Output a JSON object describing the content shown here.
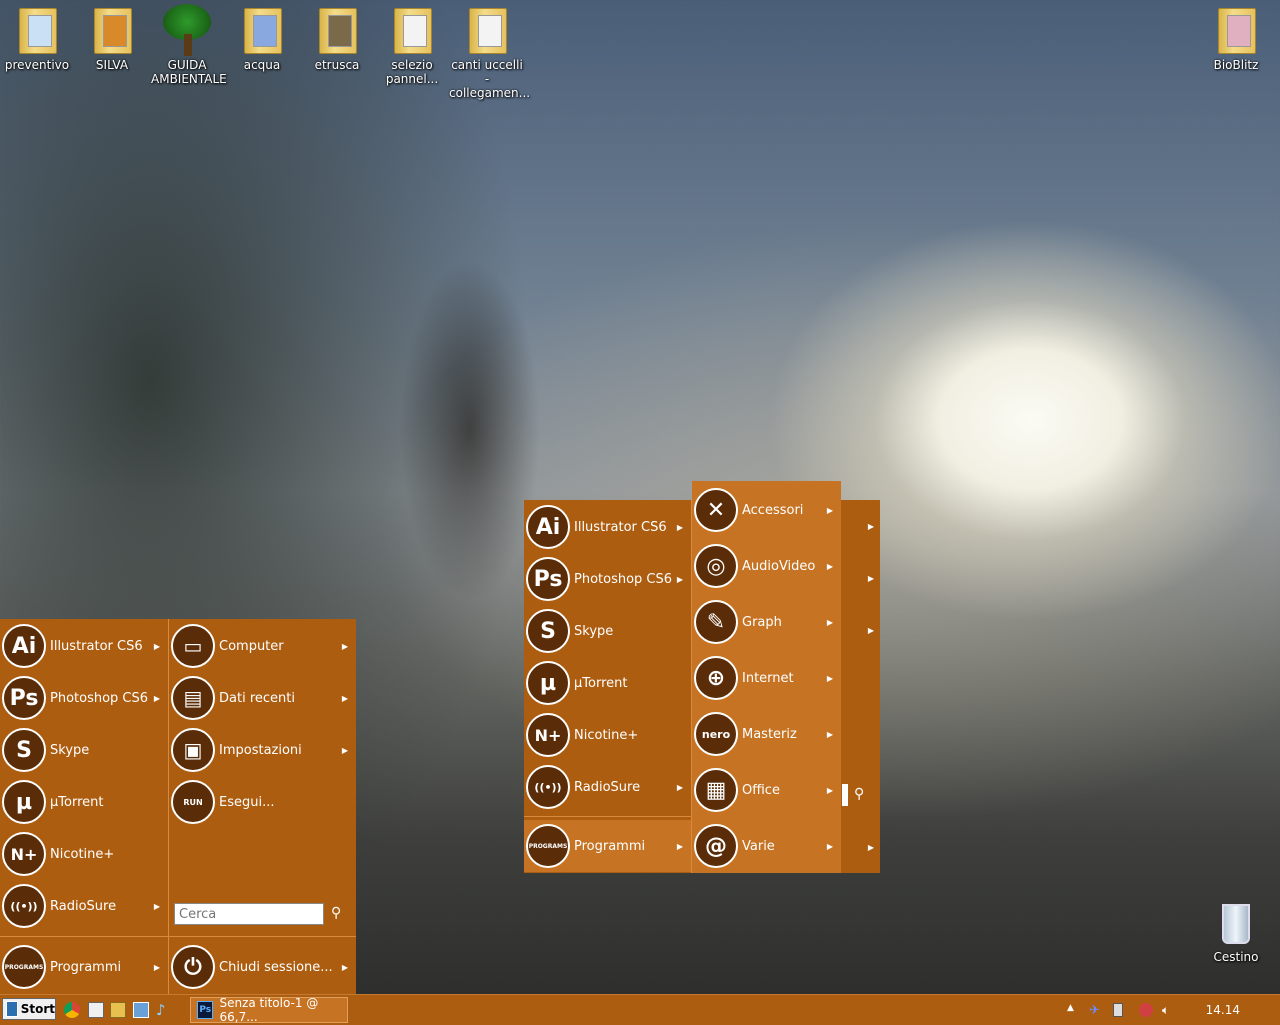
{
  "desktop": {
    "icons": [
      {
        "label": "preventivo"
      },
      {
        "label": "SILVA"
      },
      {
        "label": "GUIDA AMBIENTALE"
      },
      {
        "label": "acqua"
      },
      {
        "label": "etrusca"
      },
      {
        "label": "selezio pannel..."
      },
      {
        "label": "canti uccelli - collegamen..."
      },
      {
        "label": "BioBlitz"
      },
      {
        "label": "Cestino"
      }
    ]
  },
  "start_menu": {
    "left_items": [
      {
        "icon": "Ai",
        "label": "Illustrator CS6"
      },
      {
        "icon": "Ps",
        "label": "Photoshop CS6"
      },
      {
        "icon": "S",
        "label": "Skype"
      },
      {
        "icon": "µ",
        "label": "µTorrent"
      },
      {
        "icon": "N+",
        "label": "Nicotine+"
      },
      {
        "icon": "((•))",
        "label": "RadioSure"
      }
    ],
    "programs_label": "Programmi",
    "programs_icon": "PROGRAMS",
    "right_items": [
      {
        "label": "Computer"
      },
      {
        "label": "Dati recenti"
      },
      {
        "label": "Impostazioni"
      },
      {
        "label": "Esegui..."
      }
    ],
    "run_icon": "RUN",
    "search_placeholder": "Cerca",
    "shutdown_label": "Chiudi sessione..."
  },
  "sub_menu": {
    "items": [
      {
        "icon": "Ai",
        "label": "Illustrator CS6"
      },
      {
        "icon": "Ps",
        "label": "Photoshop CS6"
      },
      {
        "icon": "S",
        "label": "Skype"
      },
      {
        "icon": "µ",
        "label": "µTorrent"
      },
      {
        "icon": "N+",
        "label": "Nicotine+"
      },
      {
        "icon": "((•))",
        "label": "RadioSure"
      }
    ],
    "programs_label": "Programmi",
    "programs_icon": "PROGRAMS"
  },
  "programs_menu": {
    "items": [
      {
        "icon": "✕",
        "label": "Accessori"
      },
      {
        "icon": "◎",
        "label": "AudioVideo"
      },
      {
        "icon": "✎",
        "label": "Graph"
      },
      {
        "icon": "⊕",
        "label": "Internet"
      },
      {
        "icon": "nero",
        "label": "Masteriz"
      },
      {
        "icon": "▦",
        "label": "Office"
      },
      {
        "icon": "@",
        "label": "Varie"
      }
    ]
  },
  "taskbar": {
    "start_label": "Stort",
    "task_label": "Senza titolo-1 @ 66,7...",
    "task_icon": "Ps",
    "clock": "14.14"
  },
  "colors": {
    "menu_bg": "#ad5d10",
    "menu_highlight": "#c67424",
    "icon_circle": "#5a2c08"
  }
}
